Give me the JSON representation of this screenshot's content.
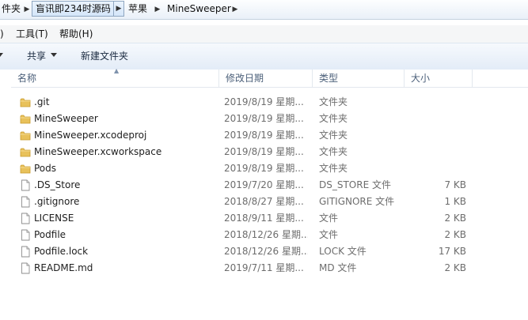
{
  "address": {
    "crumbs": [
      "件夹",
      "盲讯即234时源码",
      "苹果",
      "MineSweeper"
    ]
  },
  "menu": [
    ")",
    "工具(T)",
    "帮助(H)"
  ],
  "toolbar": {
    "share": "共享",
    "new_folder": "新建文件夹"
  },
  "columns": {
    "name": "名称",
    "date": "修改日期",
    "type": "类型",
    "size": "大小"
  },
  "files": [
    {
      "name": ".git",
      "date": "2019/8/19 星期...",
      "type": "文件夹",
      "size": "",
      "icon": "folder-icon"
    },
    {
      "name": "MineSweeper",
      "date": "2019/8/19 星期...",
      "type": "文件夹",
      "size": "",
      "icon": "folder-icon"
    },
    {
      "name": "MineSweeper.xcodeproj",
      "date": "2019/8/19 星期...",
      "type": "文件夹",
      "size": "",
      "icon": "folder-icon"
    },
    {
      "name": "MineSweeper.xcworkspace",
      "date": "2019/8/19 星期...",
      "type": "文件夹",
      "size": "",
      "icon": "folder-icon"
    },
    {
      "name": "Pods",
      "date": "2019/8/19 星期...",
      "type": "文件夹",
      "size": "",
      "icon": "folder-icon"
    },
    {
      "name": ".DS_Store",
      "date": "2019/7/20 星期...",
      "type": "DS_STORE 文件",
      "size": "7 KB",
      "icon": "file-icon"
    },
    {
      "name": ".gitignore",
      "date": "2018/8/27 星期...",
      "type": "GITIGNORE 文件",
      "size": "1 KB",
      "icon": "file-icon"
    },
    {
      "name": "LICENSE",
      "date": "2018/9/11 星期...",
      "type": "文件",
      "size": "2 KB",
      "icon": "file-icon"
    },
    {
      "name": "Podfile",
      "date": "2018/12/26 星期...",
      "type": "文件",
      "size": "2 KB",
      "icon": "file-icon"
    },
    {
      "name": "Podfile.lock",
      "date": "2018/12/26 星期...",
      "type": "LOCK 文件",
      "size": "17 KB",
      "icon": "file-icon"
    },
    {
      "name": "README.md",
      "date": "2019/7/11 星期...",
      "type": "MD 文件",
      "size": "2 KB",
      "icon": "file-icon"
    }
  ],
  "colors": {
    "folder": "#e8c15a",
    "header_text": "#4c607a",
    "meta_text": "#6d6d6d"
  }
}
